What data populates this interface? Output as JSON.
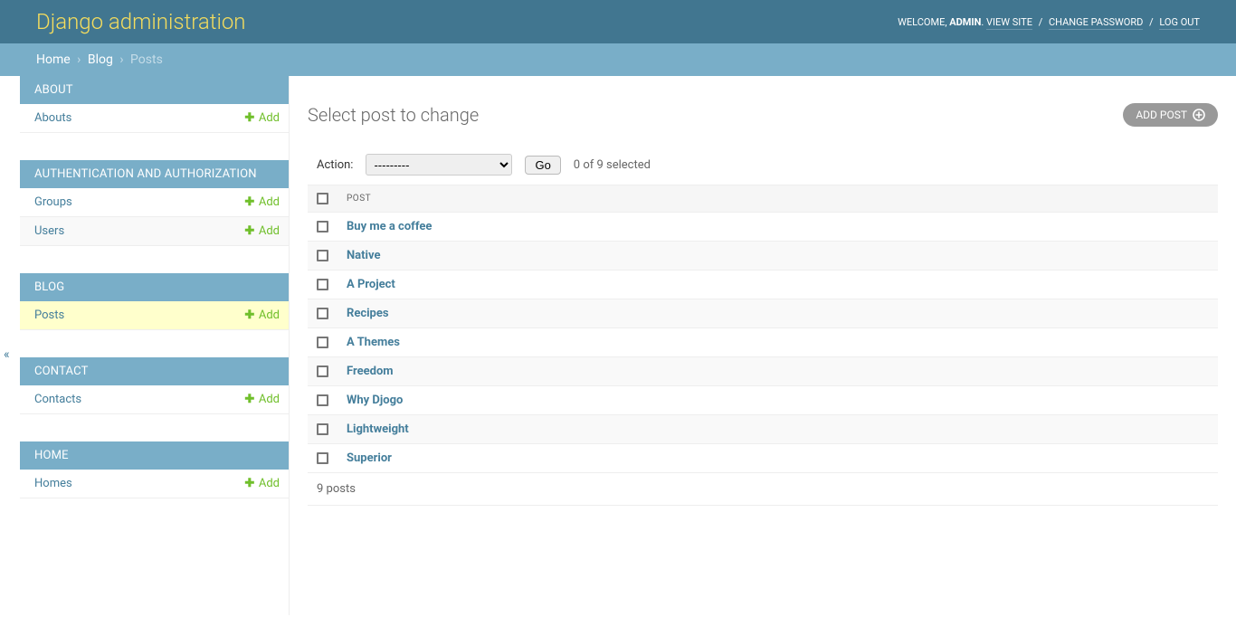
{
  "header": {
    "branding": "Django administration",
    "welcome_prefix": "WELCOME, ",
    "username": "ADMIN",
    "view_site": "VIEW SITE",
    "change_password": "CHANGE PASSWORD",
    "logout": "LOG OUT"
  },
  "breadcrumbs": {
    "home": "Home",
    "app": "Blog",
    "current": "Posts",
    "sep": "›"
  },
  "sidebar": {
    "apps": [
      {
        "caption": "ABOUT",
        "models": [
          {
            "name": "Abouts",
            "add_label": "Add",
            "selected": false
          }
        ]
      },
      {
        "caption": "AUTHENTICATION AND AUTHORIZATION",
        "models": [
          {
            "name": "Groups",
            "add_label": "Add",
            "selected": false
          },
          {
            "name": "Users",
            "add_label": "Add",
            "selected": false
          }
        ]
      },
      {
        "caption": "BLOG",
        "models": [
          {
            "name": "Posts",
            "add_label": "Add",
            "selected": true
          }
        ]
      },
      {
        "caption": "CONTACT",
        "models": [
          {
            "name": "Contacts",
            "add_label": "Add",
            "selected": false
          }
        ]
      },
      {
        "caption": "HOME",
        "models": [
          {
            "name": "Homes",
            "add_label": "Add",
            "selected": false
          }
        ]
      }
    ]
  },
  "content": {
    "title": "Select post to change",
    "add_button_label": "ADD POST",
    "action_label": "Action:",
    "action_placeholder": "---------",
    "go_label": "Go",
    "selection_count": "0 of 9 selected",
    "column_header": "POST",
    "rows": [
      {
        "title": "Buy me a coffee"
      },
      {
        "title": "Native"
      },
      {
        "title": "A Project"
      },
      {
        "title": "Recipes"
      },
      {
        "title": "A Themes"
      },
      {
        "title": "Freedom"
      },
      {
        "title": "Why Djogo"
      },
      {
        "title": "Lightweight"
      },
      {
        "title": "Superior"
      }
    ],
    "paginator": "9 posts"
  }
}
